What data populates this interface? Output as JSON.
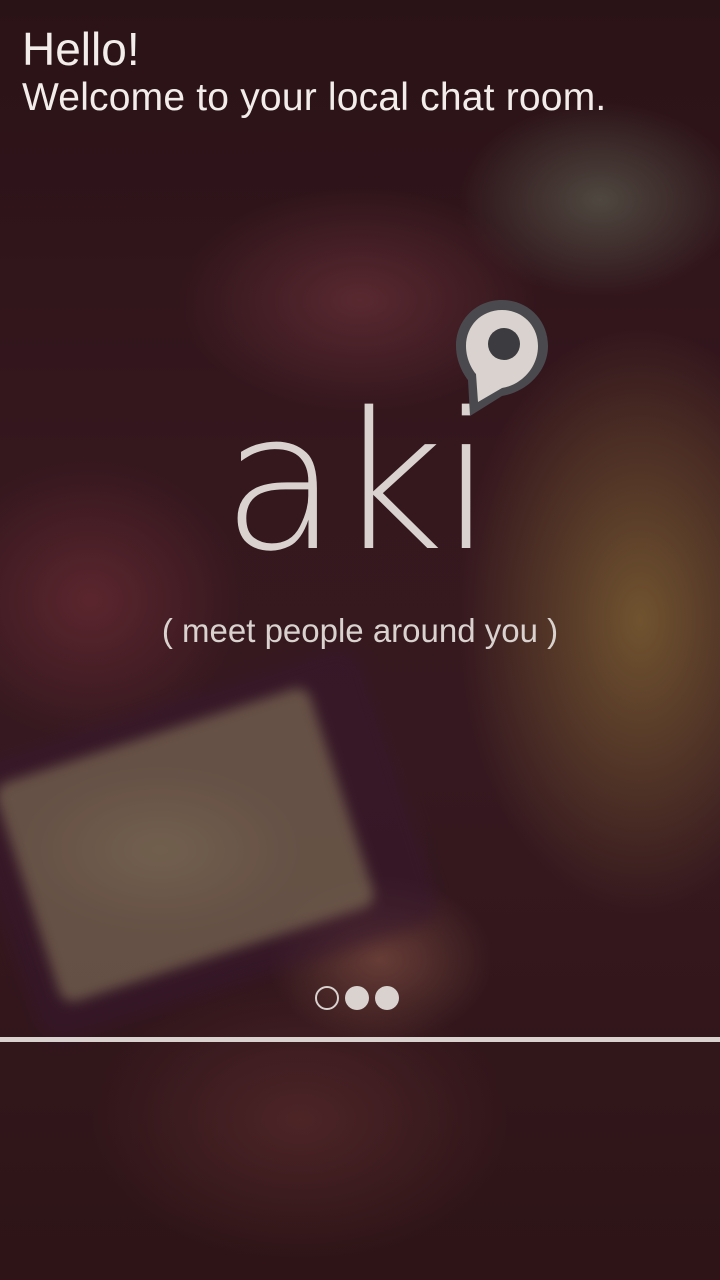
{
  "greeting": {
    "hello": "Hello!",
    "welcome": "Welcome to your local chat room."
  },
  "logo": {
    "wordmark": "aki",
    "icon": "map-pin-icon"
  },
  "tagline": "( meet people around you )",
  "pager": {
    "total_pages": 3,
    "current_page": 1
  },
  "colors": {
    "text": "#f2ecea",
    "logo": "#d9d2cf",
    "pin_fill": "#d9d2cf",
    "pin_outline": "#4a4a4e"
  }
}
